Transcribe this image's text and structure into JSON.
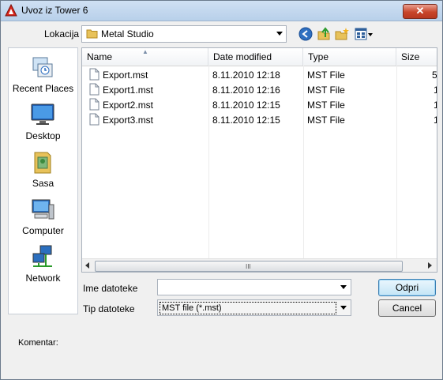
{
  "window": {
    "title": "Uvoz iz Tower 6",
    "close_label": "✕"
  },
  "location": {
    "label": "Lokacija",
    "value": "Metal Studio"
  },
  "toolbar": {
    "back": "back-icon",
    "up": "up-folder-icon",
    "new_folder": "new-folder-icon",
    "views": "views-menu-icon"
  },
  "places": [
    {
      "label": "Recent Places",
      "icon": "recent-places-icon"
    },
    {
      "label": "Desktop",
      "icon": "desktop-icon"
    },
    {
      "label": "Sasa",
      "icon": "user-folder-icon"
    },
    {
      "label": "Computer",
      "icon": "computer-icon"
    },
    {
      "label": "Network",
      "icon": "network-icon"
    }
  ],
  "columns": [
    "Name",
    "Date modified",
    "Type",
    "Size"
  ],
  "files": [
    {
      "name": "Export.mst",
      "date": "8.11.2010 12:18",
      "type": "MST File",
      "size": "5"
    },
    {
      "name": "Export1.mst",
      "date": "8.11.2010 12:16",
      "type": "MST File",
      "size": "1"
    },
    {
      "name": "Export2.mst",
      "date": "8.11.2010 12:15",
      "type": "MST File",
      "size": "1"
    },
    {
      "name": "Export3.mst",
      "date": "8.11.2010 12:15",
      "type": "MST File",
      "size": "1"
    }
  ],
  "scrollbar": {
    "grip": "III"
  },
  "filename": {
    "label": "Ime datoteke",
    "value": ""
  },
  "filetype": {
    "label": "Tip datoteke",
    "value": "MST file (*.mst)"
  },
  "buttons": {
    "open": "Odpri",
    "cancel": "Cancel"
  },
  "comment": {
    "label": "Komentar:"
  }
}
